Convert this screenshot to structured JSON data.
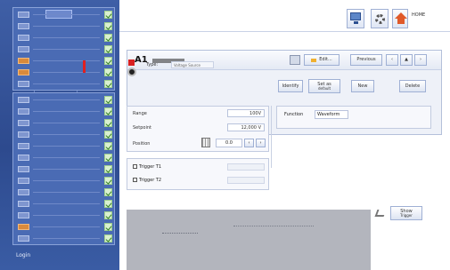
{
  "toolbar": {
    "home_label": "HOME"
  },
  "sidebar": {
    "status_label": "Login",
    "status_sub": ""
  },
  "panel": {
    "title_prefix": "A1",
    "edit_label": "Edit...",
    "nav_label": "Previous",
    "btn_prev": "‹",
    "btn_up": "▲",
    "btn_next": "›",
    "type_label": "Type:",
    "type_value": "Voltage Source",
    "btn_identify": "Identify",
    "btn_set_param": "Set as",
    "btn_set_param_sub": "default",
    "btn_new": "New",
    "btn_delete": "Delete"
  },
  "params": {
    "range_label": "Range",
    "range_value": "100V",
    "setpoint_label": "Setpoint",
    "setpoint_value": "12,000 V",
    "position_label": "Position",
    "position_value": "0.0",
    "arrow_left": "‹",
    "arrow_right": "›"
  },
  "subsystem": {
    "label": "Function",
    "value": "Waveform"
  },
  "triggers": {
    "t1": "Trigger T1",
    "t2": "Trigger T2"
  },
  "footer": {
    "btn_label": "Show",
    "btn_sub": "Trigger"
  }
}
